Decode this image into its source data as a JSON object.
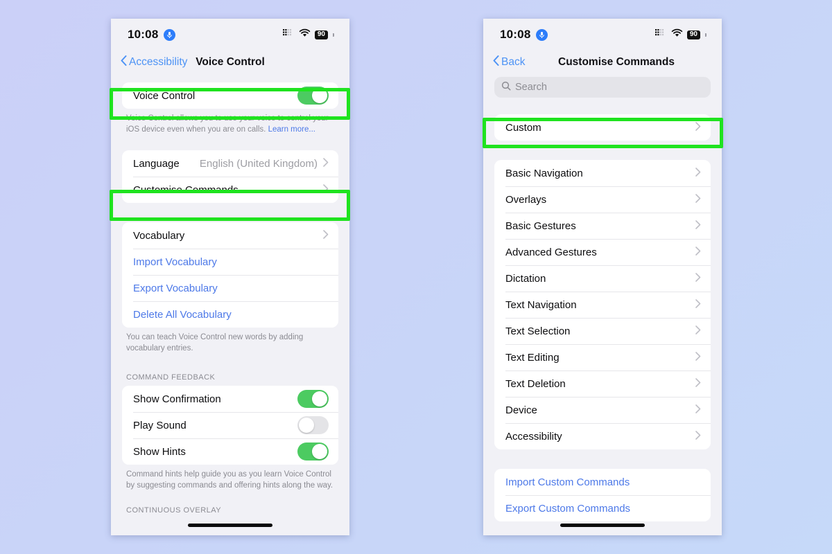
{
  "theme": {
    "accent_blue": "#4d79e8",
    "link_blue": "#4d93f5",
    "toggle_on_green": "#4ccb61",
    "highlight_green": "#1fe31f",
    "background": "#c9d4f8"
  },
  "status_bar": {
    "time": "10:08",
    "mic_icon": "microphone-icon",
    "cellular_icon": "cellular-signal-icon",
    "wifi_icon": "wifi-icon",
    "battery_level": "90"
  },
  "left_screen": {
    "nav": {
      "back_label": "Accessibility",
      "back_icon": "chevron-left-icon",
      "title": "Voice Control"
    },
    "voice_control_row": {
      "label": "Voice Control",
      "toggle_state": "on"
    },
    "voice_control_footnote": "Voice Control allows you to use your voice to control your iOS device even when you are on calls.",
    "voice_control_footnote_link": "Learn more...",
    "settings_group": [
      {
        "label": "Language",
        "value": "English (United Kingdom)",
        "chevron": "chevron-right-icon"
      },
      {
        "label": "Customise Commands",
        "value": "",
        "chevron": "chevron-right-icon"
      }
    ],
    "vocabulary_group": [
      {
        "label": "Vocabulary",
        "style": "normal",
        "chevron": "chevron-right-icon"
      },
      {
        "label": "Import Vocabulary",
        "style": "link",
        "chevron": ""
      },
      {
        "label": "Export Vocabulary",
        "style": "link",
        "chevron": ""
      },
      {
        "label": "Delete All Vocabulary",
        "style": "link",
        "chevron": ""
      }
    ],
    "vocabulary_footnote": "You can teach Voice Control new words by adding vocabulary entries.",
    "command_feedback_header": "COMMAND FEEDBACK",
    "command_feedback_rows": [
      {
        "label": "Show Confirmation",
        "toggle_state": "on"
      },
      {
        "label": "Play Sound",
        "toggle_state": "off"
      },
      {
        "label": "Show Hints",
        "toggle_state": "on"
      }
    ],
    "command_feedback_footnote": "Command hints help guide you as you learn Voice Control by suggesting commands and offering hints along the way.",
    "continuous_overlay_header": "CONTINUOUS OVERLAY"
  },
  "right_screen": {
    "nav": {
      "back_label": "Back",
      "back_icon": "chevron-left-icon",
      "title": "Customise Commands"
    },
    "search": {
      "placeholder": "Search",
      "icon": "search-icon",
      "value": ""
    },
    "custom_group": [
      {
        "label": "Custom",
        "chevron": "chevron-right-icon"
      }
    ],
    "categories_group": [
      {
        "label": "Basic Navigation",
        "chevron": "chevron-right-icon"
      },
      {
        "label": "Overlays",
        "chevron": "chevron-right-icon"
      },
      {
        "label": "Basic Gestures",
        "chevron": "chevron-right-icon"
      },
      {
        "label": "Advanced Gestures",
        "chevron": "chevron-right-icon"
      },
      {
        "label": "Dictation",
        "chevron": "chevron-right-icon"
      },
      {
        "label": "Text Navigation",
        "chevron": "chevron-right-icon"
      },
      {
        "label": "Text Selection",
        "chevron": "chevron-right-icon"
      },
      {
        "label": "Text Editing",
        "chevron": "chevron-right-icon"
      },
      {
        "label": "Text Deletion",
        "chevron": "chevron-right-icon"
      },
      {
        "label": "Device",
        "chevron": "chevron-right-icon"
      },
      {
        "label": "Accessibility",
        "chevron": "chevron-right-icon"
      }
    ],
    "import_export_group": [
      {
        "label": "Import Custom Commands",
        "style": "link"
      },
      {
        "label": "Export Custom Commands",
        "style": "link"
      }
    ]
  }
}
